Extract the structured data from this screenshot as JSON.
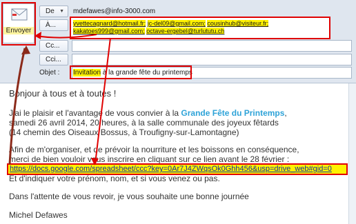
{
  "send_button": {
    "label": "Envoyer"
  },
  "fields": {
    "from": {
      "button": "De",
      "value": "mdefawes@info-3000.com"
    },
    "to": {
      "button": "À...",
      "recipients": [
        "yvettecagnard@hotmail.fr;",
        "jc-del09@gmail.com;",
        "cousinhub@visiteur.fr;",
        "kakatoes999@gmail.com;",
        "octave-ergebel@turlututu.ch"
      ]
    },
    "cc": {
      "button": "Cc..."
    },
    "bcc": {
      "button": "Cci..."
    },
    "subject": {
      "label": "Objet :",
      "highlight": "Invitation",
      "rest": " à la grande fête du printemps"
    }
  },
  "body": {
    "greeting": "Bonjour à tous et à toutes !",
    "p1_a": "J'ai le plaisir et l'avantage de vous convier à la ",
    "event_name": "Grande Fête du Printemps",
    "p1_b": ",",
    "p1_line2": "samedi 26 avril 2014, 20 heures, à la salle communale des joyeux fêtards",
    "p1_line3": "(14 chemin des Oiseaux Bossus, à Troufigny-sur-Lamontagne)",
    "p2_line1": "Afin de m'organiser, et de prévoir la nourriture et les boissons en conséquence,",
    "p2_line2": "merci de bien vouloir vous inscrire en cliquant sur ce lien avant le 28 février :",
    "link": "https://docs.google.com/spreadsheet/ccc?key=0Ar7J4ZWqsOk0Ghh456&usp=drive_web#gid=0",
    "p2_line3": "Et d'indiquer votre prénom, nom, et si vous venez ou pas.",
    "closing": "Dans l'attente de vous revoir, je vous souhaite une bonne journée",
    "signature": "Michel Defawes"
  },
  "colors": {
    "annotation": "#e00000",
    "highlight": "#fff200",
    "event_name": "#2ea3d8",
    "link": "#0d2f9e"
  }
}
